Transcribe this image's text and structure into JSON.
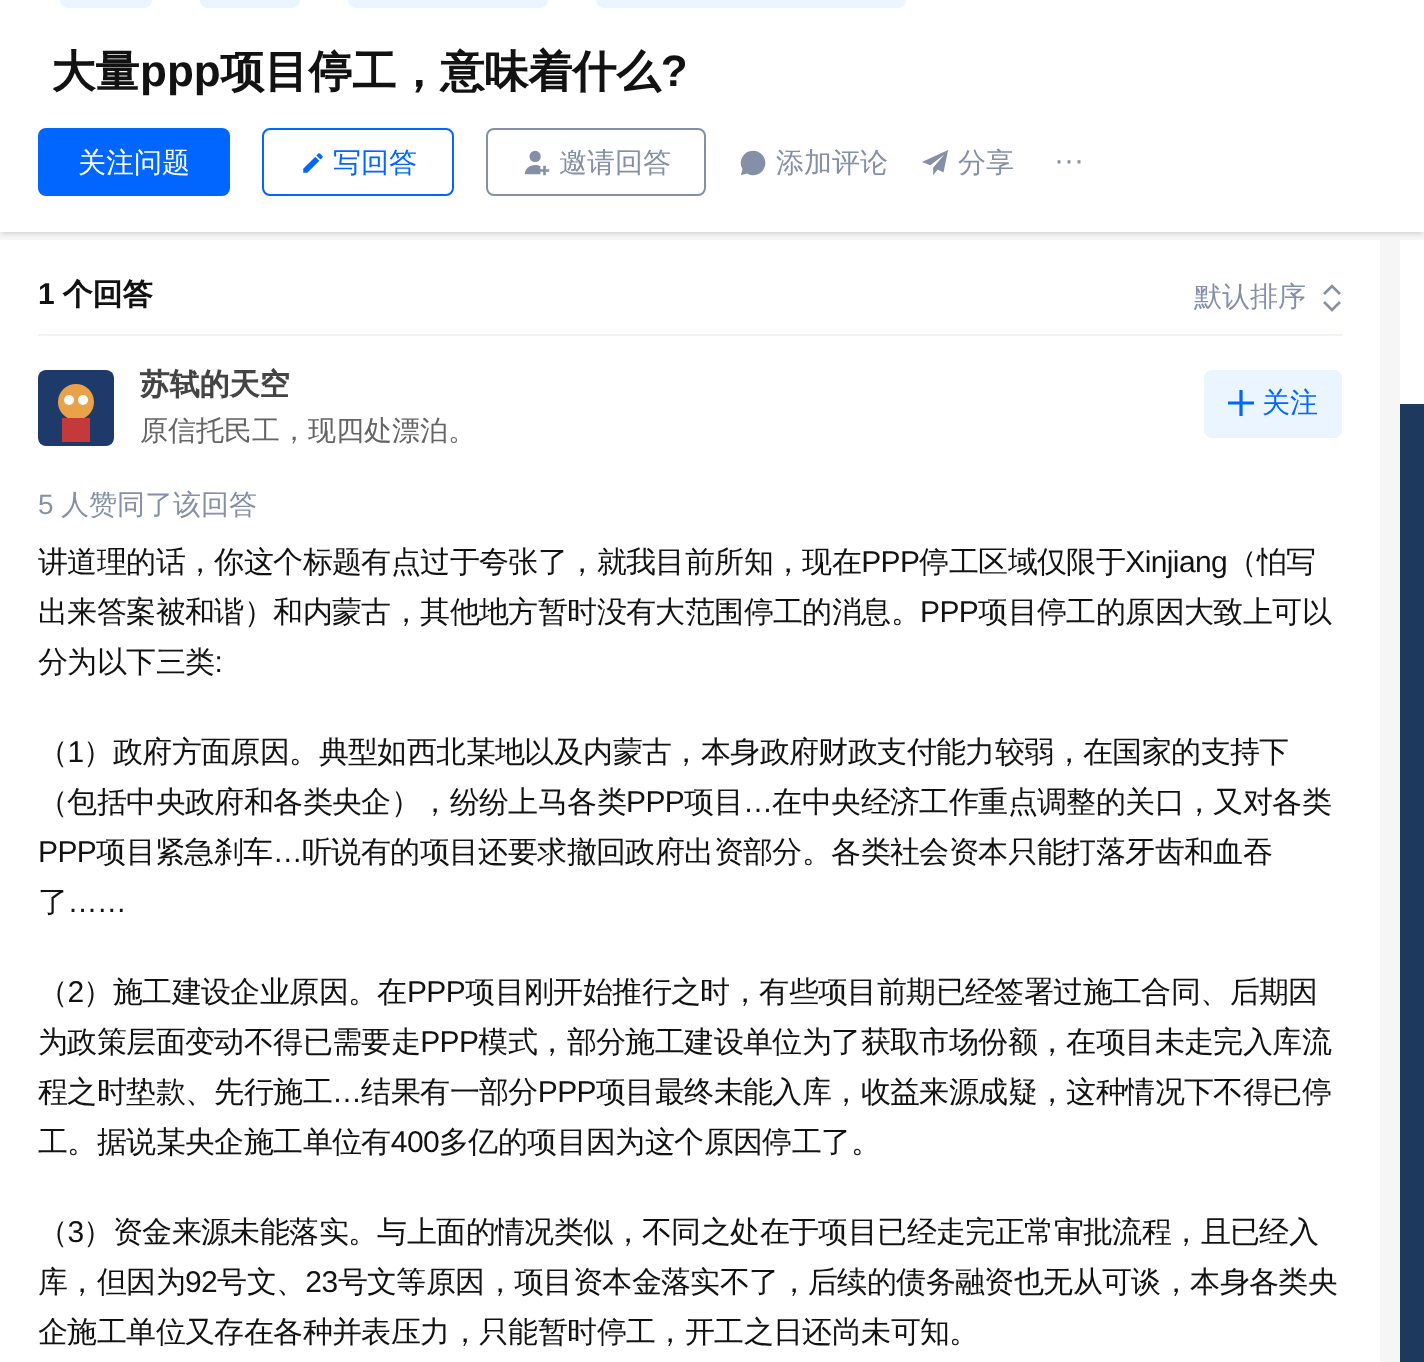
{
  "question": {
    "title": "大量ppp项目停工，意味着什么?"
  },
  "actions": [
    {
      "kind": "primary",
      "label": "关注问题"
    },
    {
      "kind": "write",
      "label": "写回答"
    },
    {
      "kind": "invite",
      "label": "邀请回答"
    },
    {
      "kind": "comment",
      "label": "添加评论"
    },
    {
      "kind": "share",
      "label": "分享"
    },
    {
      "kind": "more",
      "label": "···"
    }
  ],
  "answers_header": {
    "count": "1 个回答",
    "sort": "默认排序"
  },
  "answer": {
    "author": "苏轼的天空",
    "bio": "原信托民工，现四处漂泊。",
    "follow": "关注",
    "votes": "5 人赞同了该回答",
    "paragraphs": [
      "讲道理的话，你这个标题有点过于夸张了，就我目前所知，现在PPP停工区域仅限于Xinjiang（怕写出来答案被和谐）和内蒙古，其他地方暂时没有大范围停工的消息。PPP项目停工的原因大致上可以分为以下三类:",
      "（1）政府方面原因。典型如西北某地以及内蒙古，本身政府财政支付能力较弱，在国家的支持下（包括中央政府和各类央企），纷纷上马各类PPP项目…在中央经济工作重点调整的关口，又对各类PPP项目紧急刹车…听说有的项目还要求撤回政府出资部分。各类社会资本只能打落牙齿和血吞了……",
      "（2）施工建设企业原因。在PPP项目刚开始推行之时，有些项目前期已经签署过施工合同、后期因为政策层面变动不得已需要走PPP模式，部分施工建设单位为了获取市场份额，在项目未走完入库流程之时垫款、先行施工…结果有一部分PPP项目最终未能入库，收益来源成疑，这种情况下不得已停工。据说某央企施工单位有400多亿的项目因为这个原因停工了。",
      "（3）资金来源未能落实。与上面的情况类似，不同之处在于项目已经走完正常审批流程，且已经入库，但因为92号文、23号文等原因，项目资本金落实不了，后续的债务融资也无从可谈，本身各类央企施工单位又存在各种并表压力，只能暂时停工，开工之日还尚未可知。"
    ]
  }
}
